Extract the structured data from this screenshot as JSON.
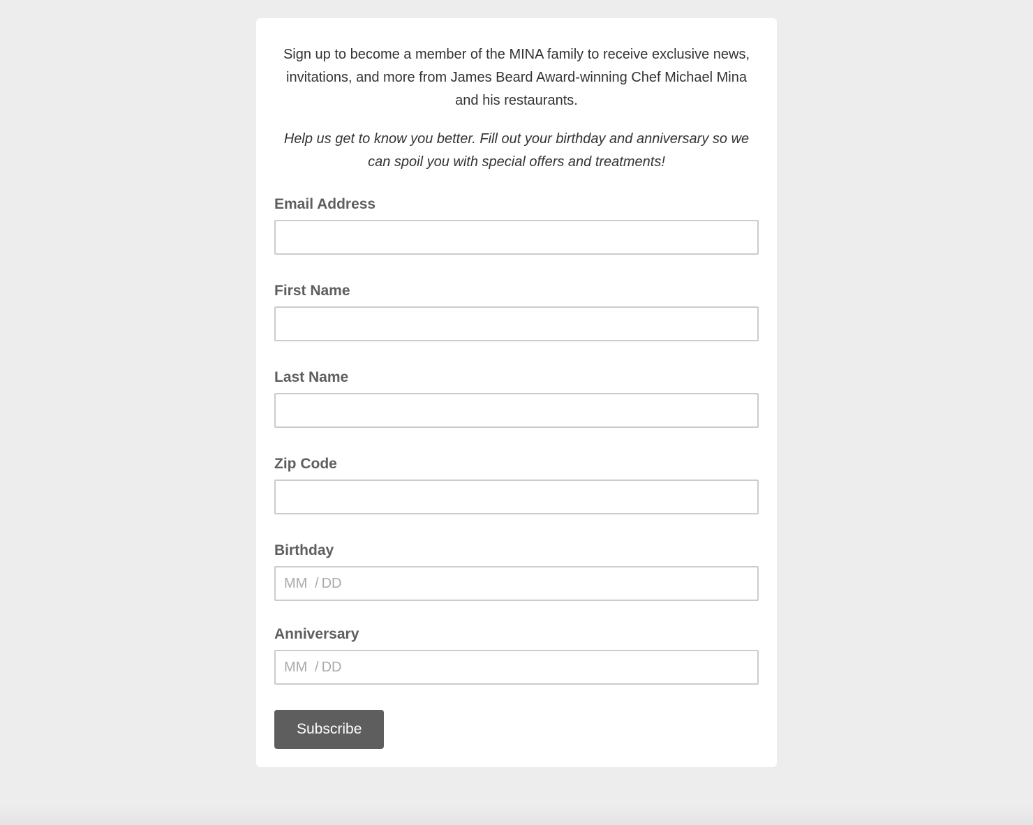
{
  "intro": "Sign up to become a member of the MINA family to receive exclusive news, invitations, and more from James Beard Award-winning Chef Michael Mina and his restaurants.",
  "help": "Help us get to know you better. Fill out your birthday and anniversary so we can spoil you with special offers and treatments!",
  "fields": {
    "email": {
      "label": "Email Address",
      "value": ""
    },
    "first_name": {
      "label": "First Name",
      "value": ""
    },
    "last_name": {
      "label": "Last Name",
      "value": ""
    },
    "zip_code": {
      "label": "Zip Code",
      "value": ""
    },
    "birthday": {
      "label": "Birthday",
      "mm_placeholder": "MM",
      "dd_placeholder": "DD",
      "separator": "/"
    },
    "anniversary": {
      "label": "Anniversary",
      "mm_placeholder": "MM",
      "dd_placeholder": "DD",
      "separator": "/"
    }
  },
  "submit_label": "Subscribe"
}
